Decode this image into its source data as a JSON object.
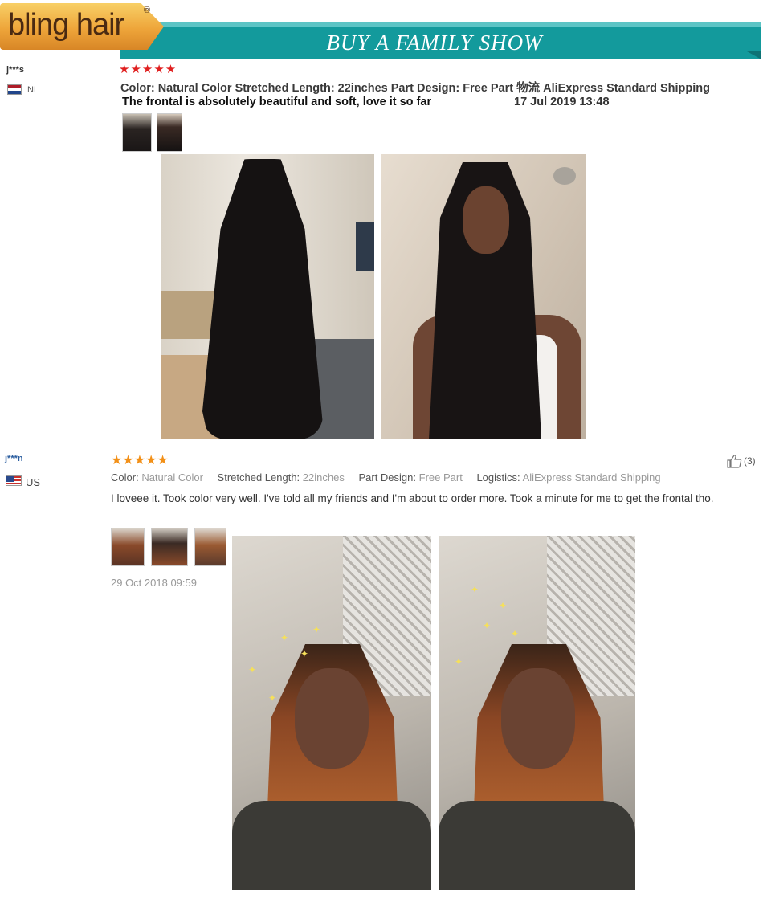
{
  "header": {
    "logo_text": "bling hair",
    "logo_reg": "®",
    "title": "BUY A FAMILY SHOW"
  },
  "review1": {
    "name": "j***s",
    "country": "NL",
    "stars": "★★★★★",
    "meta": "Color: Natural Color Stretched Length: 22inches Part Design: Free Part 物流 AliExpress Standard Shipping",
    "comment": "The frontal is absolutely beautiful and soft, love it so far",
    "date": "17 Jul 2019 13:48"
  },
  "review2": {
    "name": "j***n",
    "country": "US",
    "stars": "★★★★★",
    "helpful_count": "(3)",
    "meta": {
      "color_label": "Color:",
      "color_value": "Natural Color",
      "length_label": "Stretched Length:",
      "length_value": "22inches",
      "part_label": "Part Design:",
      "part_value": "Free Part",
      "logistics_label": "Logistics:",
      "logistics_value": "AliExpress Standard Shipping"
    },
    "comment": "I loveee it. Took color very well. I've told all my friends and I'm about to order more. Took a minute for me to get the frontal tho.",
    "date": "29 Oct 2018 09:59"
  },
  "colors": {
    "banner": "#139a9c",
    "logo": "#eea53a",
    "star_red": "#e02020",
    "star_orange": "#f29018"
  }
}
